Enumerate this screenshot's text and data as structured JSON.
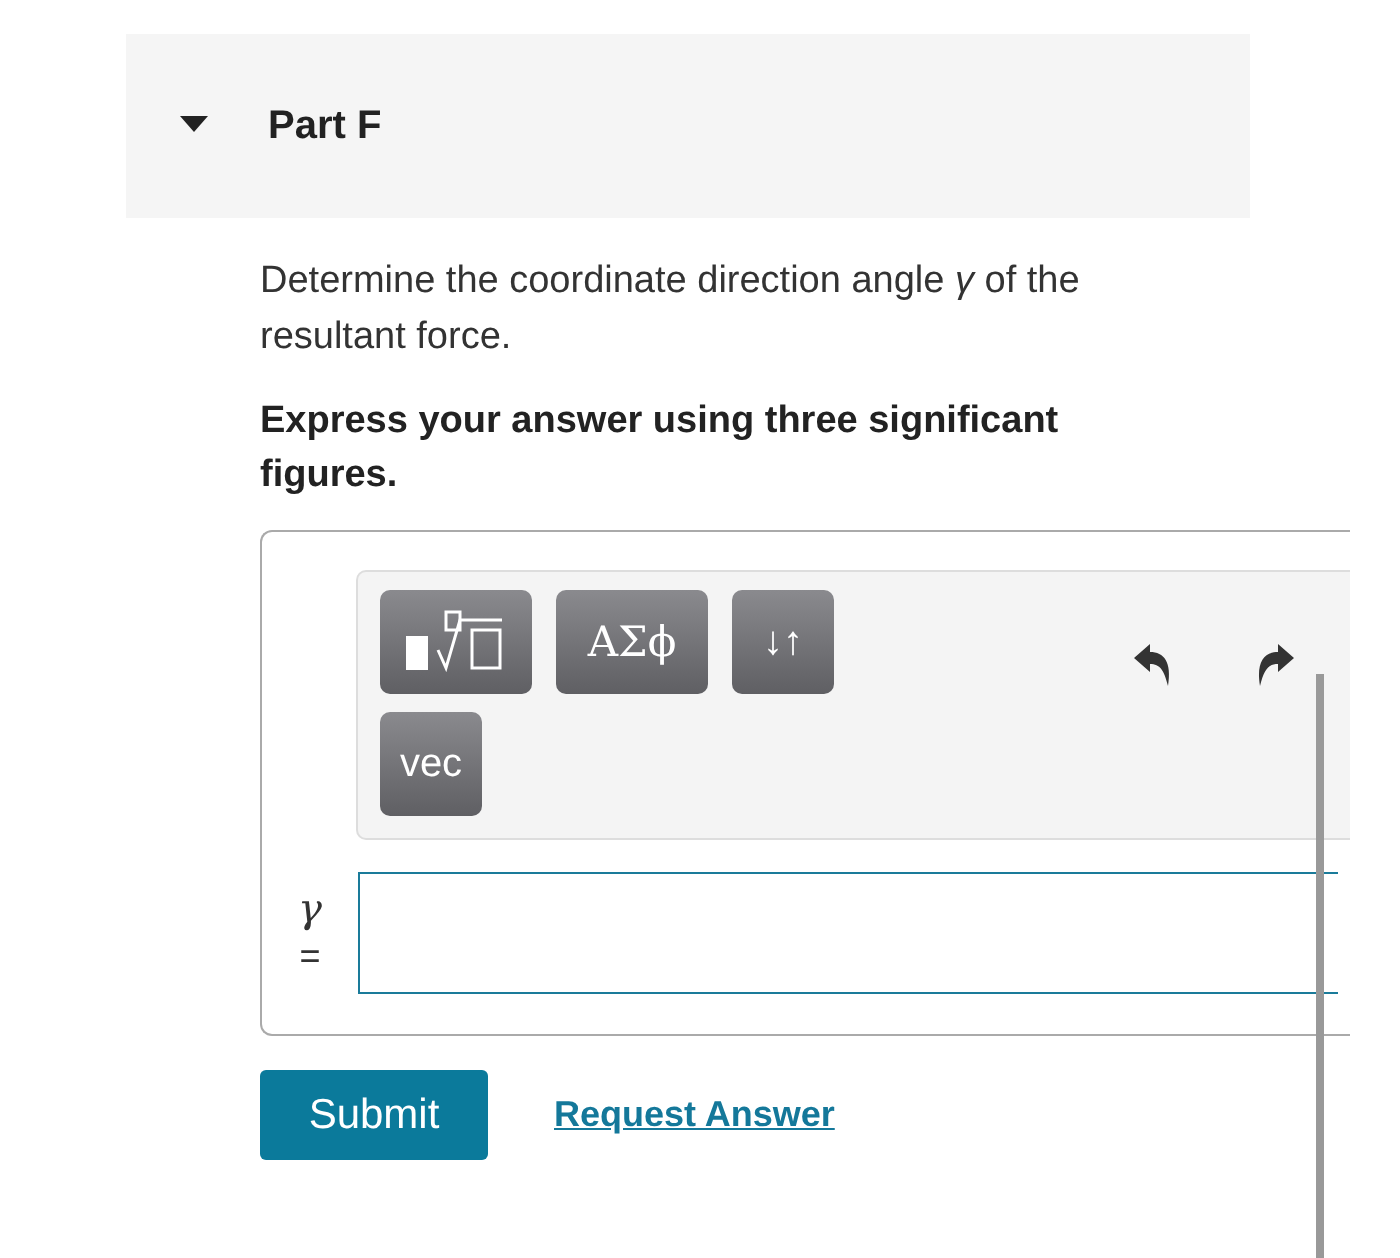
{
  "part": {
    "title": "Part F",
    "expanded": true
  },
  "question": {
    "prompt": "Determine the coordinate direction angle *γ* of the resultant force.",
    "instruction": "Express your answer using three significant figures."
  },
  "toolbar": {
    "buttons": [
      {
        "kind": "template"
      },
      {
        "kind": "text",
        "label": "ΑΣϕ"
      },
      {
        "kind": "text",
        "label": "↓↑"
      },
      {
        "kind": "text",
        "label": "vec"
      }
    ]
  },
  "answer": {
    "variable": "γ",
    "equals": "="
  },
  "actions": {
    "submit": "Submit",
    "request": "Request Answer"
  }
}
